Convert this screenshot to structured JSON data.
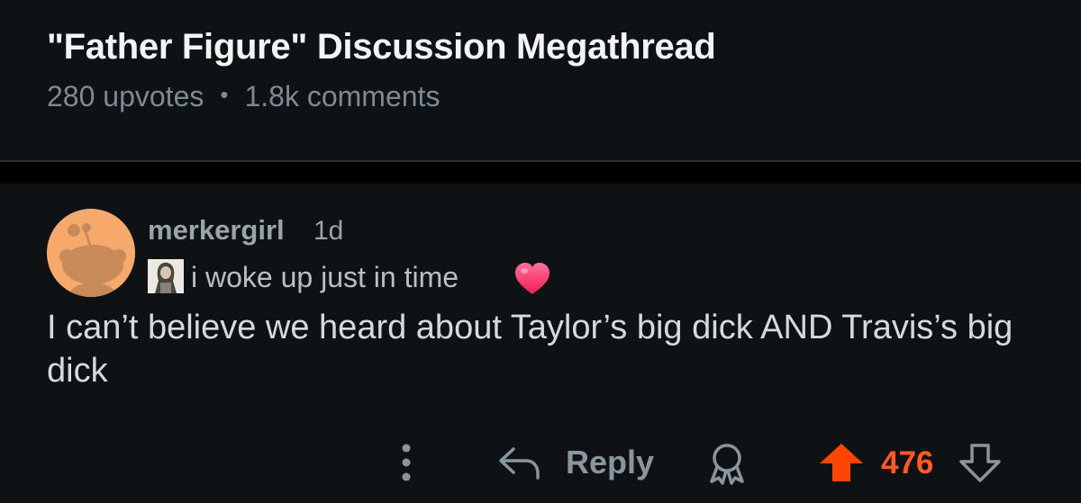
{
  "post": {
    "title": "\"Father Figure\" Discussion Megathread",
    "upvotes": "280 upvotes",
    "separator": "•",
    "comments": "1.8k comments"
  },
  "comment": {
    "username": "merkergirl",
    "timestamp": "1d",
    "flair_text": "i woke up just in time",
    "flair_emoji": "heart-icon",
    "body": "I can’t believe we heard about Taylor’s big dick AND Travis’s big dick",
    "actions": {
      "more_icon": "more-vertical-icon",
      "reply_icon": "reply-arrow-icon",
      "reply_label": "Reply",
      "award_icon": "award-icon",
      "upvote_icon": "upvote-arrow-icon",
      "vote_count": "476",
      "downvote_icon": "downvote-arrow-icon"
    }
  },
  "colors": {
    "background": "#0e1215",
    "title": "#f2f4f5",
    "meta": "#7c8a93",
    "avatar": "#f7a96b",
    "upvote": "#ff4500",
    "vote_count": "#ff5a1f",
    "heart": "#ff2d6f"
  }
}
